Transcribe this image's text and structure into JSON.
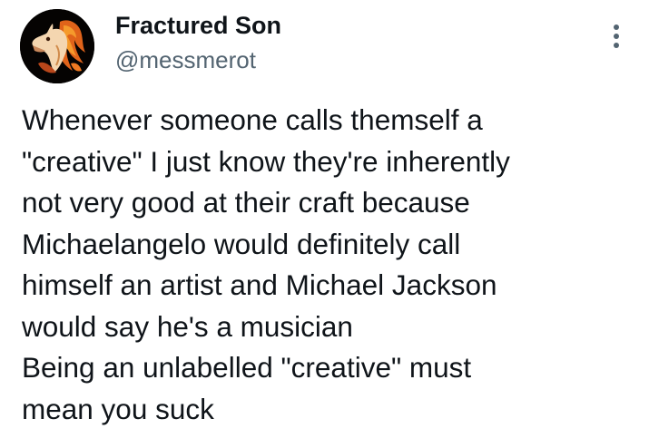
{
  "author": {
    "display_name": "Fractured Son",
    "handle": "@messmerot",
    "avatar_icon": "fire-horse-avatar"
  },
  "more_icon": "more-options-icon",
  "tweet": {
    "text": "Whenever someone calls themself a\n\"creative\" I just know they're inherently\nnot very good at their craft because\nMichaelangelo would definitely call\nhimself an artist and Michael Jackson\nwould say he's a musician\nBeing an unlabelled \"creative\" must\nmean you suck"
  },
  "colors": {
    "text": "#0f1419",
    "secondary": "#536471",
    "background": "#ffffff"
  }
}
